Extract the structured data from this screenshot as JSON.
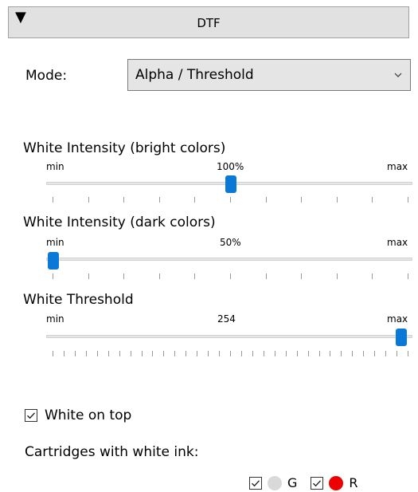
{
  "panel": {
    "title": "DTF"
  },
  "mode": {
    "label": "Mode:",
    "value": "Alpha / Threshold"
  },
  "sliders": [
    {
      "title": "White Intensity (bright colors)",
      "min_label": "min",
      "max_label": "max",
      "value_text": "100%",
      "value": 0.5
    },
    {
      "title": "White Intensity (dark colors)",
      "min_label": "min",
      "max_label": "max",
      "value_text": "50%",
      "value": 0.0
    },
    {
      "title": "White Threshold",
      "min_label": "min",
      "max_label": "max",
      "value_text": "254",
      "value": 0.98
    }
  ],
  "white_on_top": {
    "label": "White on top",
    "checked": true
  },
  "cartridges": {
    "label": "Cartridges with white ink:",
    "items": [
      {
        "letter": "G",
        "checked": true,
        "color": "#d9d9d9"
      },
      {
        "letter": "R",
        "checked": true,
        "color": "#ee0000"
      }
    ]
  }
}
